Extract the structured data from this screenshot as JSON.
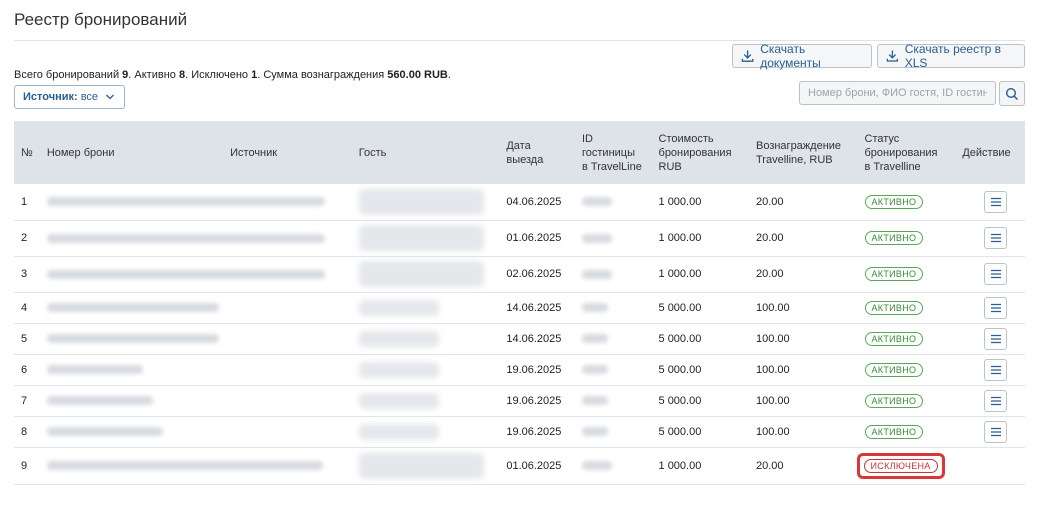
{
  "page": {
    "title": "Реестр бронирований"
  },
  "toolbar": {
    "download_docs": "Скачать документы",
    "download_registry": "Скачать реестр в XLS"
  },
  "summary": {
    "total_label": "Всего бронирований",
    "total": "9",
    "active_label": "Активно",
    "active": "8",
    "excluded_label": "Исключено",
    "excluded": "1",
    "sum_label": "Сумма вознаграждения",
    "sum": "560.00 RUB"
  },
  "filter": {
    "source_label": "Источник:",
    "source_value": "все"
  },
  "search": {
    "placeholder": "Номер брони, ФИО гостя, ID гостиницы"
  },
  "table": {
    "headers": {
      "num": "№",
      "booking": "Номер брони",
      "source": "Источник",
      "guest": "Гость",
      "date_line1": "Дата",
      "date_line2": "выезда",
      "hotel_line1": "ID",
      "hotel_line2": "гостиницы",
      "hotel_line3": "в TravelLine",
      "cost_line1": "Стоимость",
      "cost_line2": "бронирования",
      "cost_line3": "RUB",
      "reward_line1": "Вознаграждение",
      "reward_line2": "Travelline, RUB",
      "status_line1": "Статус",
      "status_line2": "бронирования",
      "status_line3": "в Travelline",
      "action": "Действие"
    },
    "rows": [
      {
        "num": "1",
        "date": "04.06.2025",
        "cost": "1 000.00",
        "reward": "20.00",
        "status": "АКТИВНО"
      },
      {
        "num": "2",
        "date": "01.06.2025",
        "cost": "1 000.00",
        "reward": "20.00",
        "status": "АКТИВНО"
      },
      {
        "num": "3",
        "date": "02.06.2025",
        "cost": "1 000.00",
        "reward": "20.00",
        "status": "АКТИВНО"
      },
      {
        "num": "4",
        "date": "14.06.2025",
        "cost": "5 000.00",
        "reward": "100.00",
        "status": "АКТИВНО"
      },
      {
        "num": "5",
        "date": "14.06.2025",
        "cost": "5 000.00",
        "reward": "100.00",
        "status": "АКТИВНО"
      },
      {
        "num": "6",
        "date": "19.06.2025",
        "cost": "5 000.00",
        "reward": "100.00",
        "status": "АКТИВНО"
      },
      {
        "num": "7",
        "date": "19.06.2025",
        "cost": "5 000.00",
        "reward": "100.00",
        "status": "АКТИВНО"
      },
      {
        "num": "8",
        "date": "19.06.2025",
        "cost": "5 000.00",
        "reward": "100.00",
        "status": "АКТИВНО"
      },
      {
        "num": "9",
        "date": "01.06.2025",
        "cost": "1 000.00",
        "reward": "20.00",
        "status": "ИСКЛЮЧЕНА"
      }
    ]
  },
  "colors": {
    "accent": "#2a5e91",
    "active": "#3a8a3a",
    "excluded": "#cc3333",
    "header_bg": "#dde3e9"
  },
  "icons": {
    "download": "download-icon",
    "search": "search-icon",
    "menu": "menu-icon",
    "chevron": "chevron-down-icon"
  }
}
